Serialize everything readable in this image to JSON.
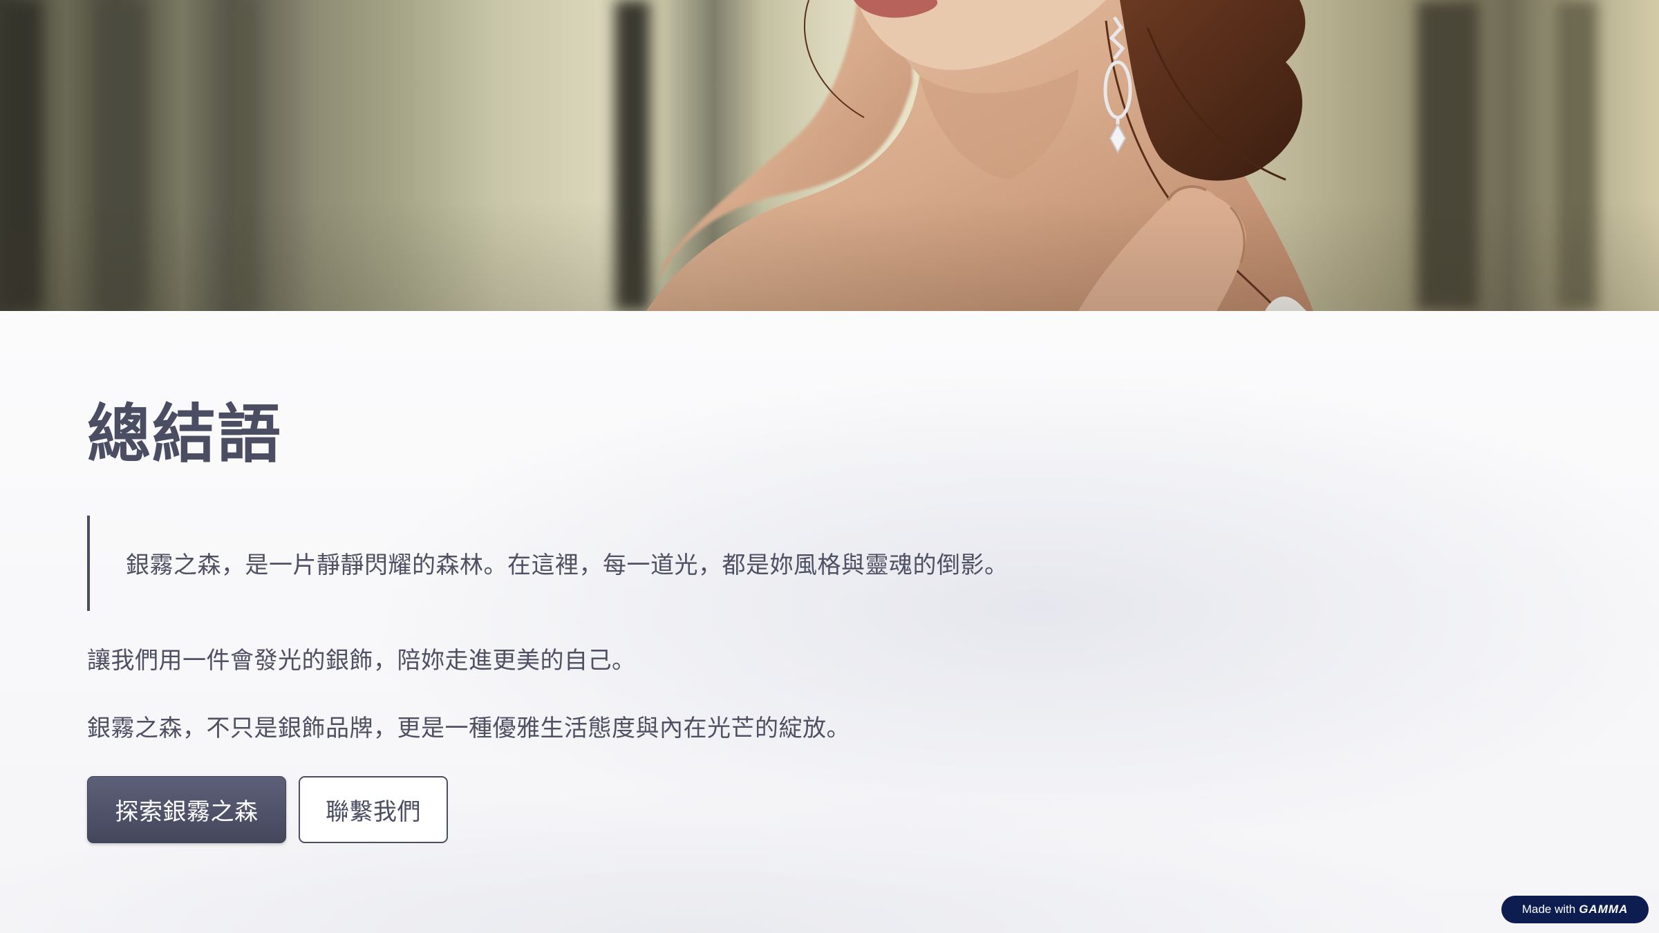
{
  "hero": {
    "image": "woman-with-silver-drop-earring-in-misty-forest"
  },
  "main": {
    "title": "總結語",
    "quote": "銀霧之森，是一片靜靜閃耀的森林。在這裡，每一道光，都是妳風格與靈魂的倒影。",
    "paragraphs": [
      "讓我們用一件會發光的銀飾，陪妳走進更美的自己。",
      "銀霧之森，不只是銀飾品牌，更是一種優雅生活態度與內在光芒的綻放。"
    ],
    "buttons": {
      "primary": "探索銀霧之森",
      "secondary": "聯繫我們"
    }
  },
  "badge": {
    "prefix": "Made with",
    "brand": "GAMMA"
  },
  "colors": {
    "accent": "#4b4d63",
    "badge_bg": "#0d1d4f",
    "text": "#4f5063"
  }
}
